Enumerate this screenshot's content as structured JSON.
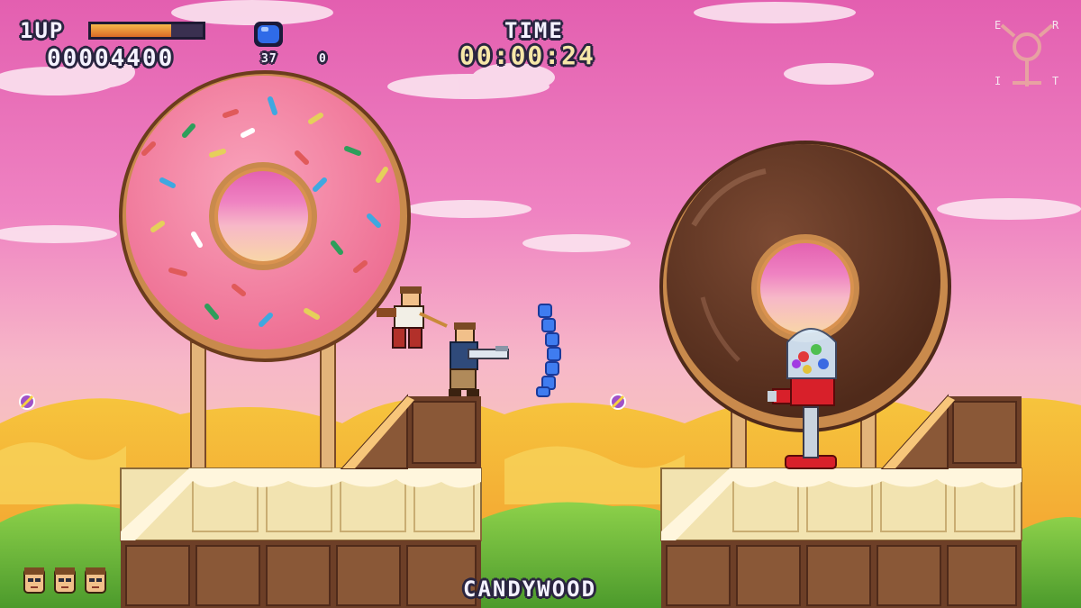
{
  "hud": {
    "player_label": "1UP",
    "score": "00004400",
    "health_fraction": 0.72,
    "gem_icon": "blue-gem-icon",
    "gem_count": "37",
    "secondary_count": "0",
    "time_label": "TIME",
    "timer": "00:00:24",
    "lives": 3,
    "emblem_letters": {
      "top_left": "E",
      "top_right": "R",
      "bottom_left": "I",
      "bottom_right": "T"
    }
  },
  "level": {
    "name": "CANDYWOOD"
  },
  "colors": {
    "sky_top": "#e35fb0",
    "sky_bottom": "#f6c9c8",
    "pink_frosting": "#f47fa0",
    "chocolate": "#6d3f27",
    "milk_chocolate": "#8a5837",
    "white_chocolate": "#f2e3b0",
    "gem_blue": "#2f6be8"
  }
}
